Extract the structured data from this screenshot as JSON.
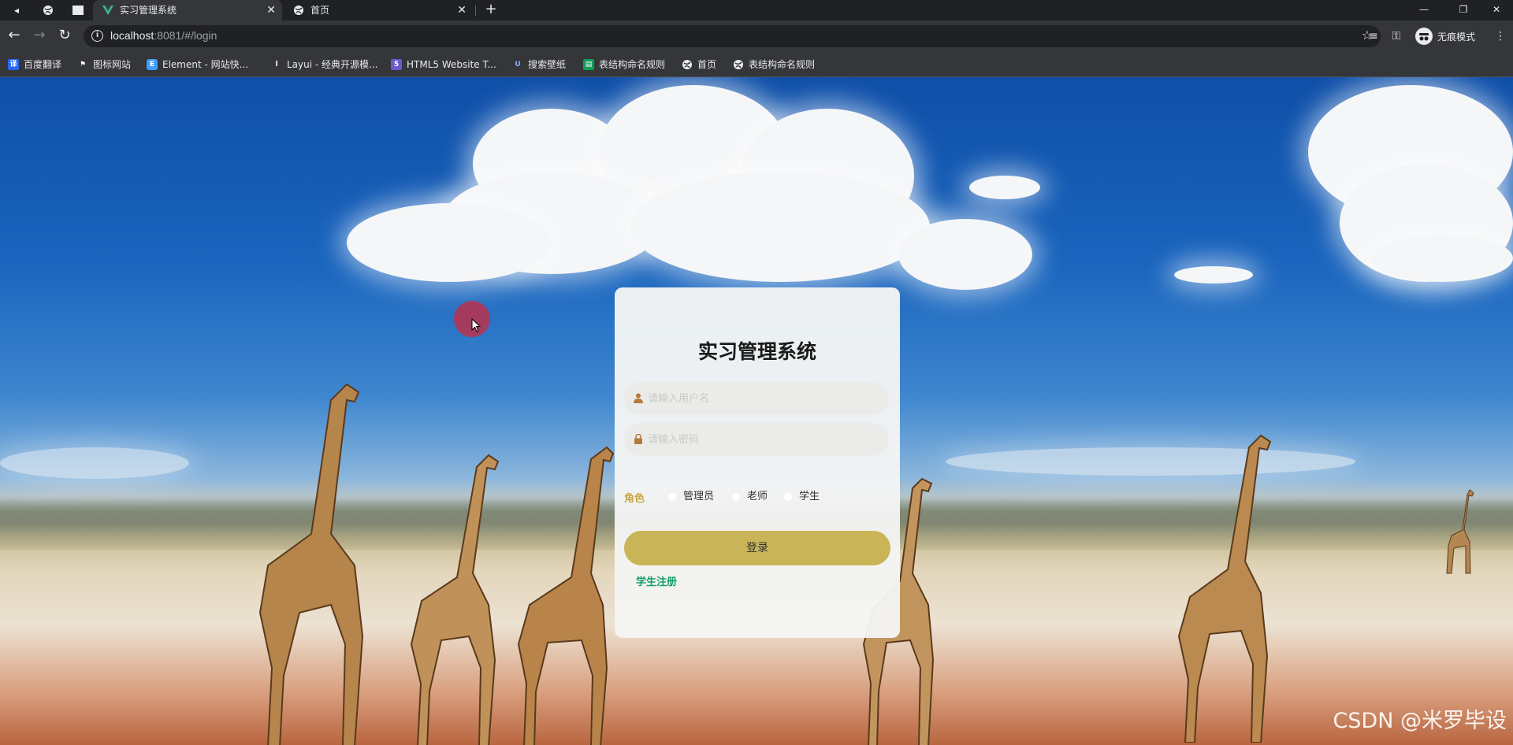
{
  "browser": {
    "tabs": [
      {
        "title": "实习管理系统",
        "active": true,
        "favicon": "vue-logo-icon"
      },
      {
        "title": "首页",
        "active": false,
        "favicon": "globe-icon"
      }
    ],
    "address": {
      "host": "localhost",
      "rest": ":8081/#/login"
    },
    "profile_label": "无痕模式",
    "bookmarks": [
      {
        "label": "百度翻译",
        "icon": "baidu-translate-icon",
        "color": "#2468f2"
      },
      {
        "label": "图标网站",
        "icon": "flag-icon",
        "color": "#202124"
      },
      {
        "label": "Element - 网站快...",
        "icon": "element-icon",
        "color": "#409eff"
      },
      {
        "label": "Layui - 经典开源模...",
        "icon": "layui-icon",
        "color": "#35363a"
      },
      {
        "label": "HTML5 Website T...",
        "icon": "html5-icon",
        "color": "#6a5acd"
      },
      {
        "label": "搜索壁纸",
        "icon": "wallpaper-icon",
        "color": "#35363a"
      },
      {
        "label": "表结构命名规则",
        "icon": "sheet-icon",
        "color": "#0f9d58"
      },
      {
        "label": "首页",
        "icon": "globe-icon",
        "color": "#35363a"
      },
      {
        "label": "表结构命名规则",
        "icon": "globe-icon",
        "color": "#35363a"
      }
    ]
  },
  "login": {
    "title": "实习管理系统",
    "username_placeholder": "请输入用户名",
    "password_placeholder": "请输入密码",
    "role_label": "角色",
    "roles": [
      "管理员",
      "老师",
      "学生"
    ],
    "login_button": "登录",
    "register_link": "学生注册"
  },
  "watermark": "CSDN @米罗毕设",
  "colors": {
    "login_button": "#c9b557",
    "register_link": "#149e6a",
    "role_label": "#c8a640"
  }
}
